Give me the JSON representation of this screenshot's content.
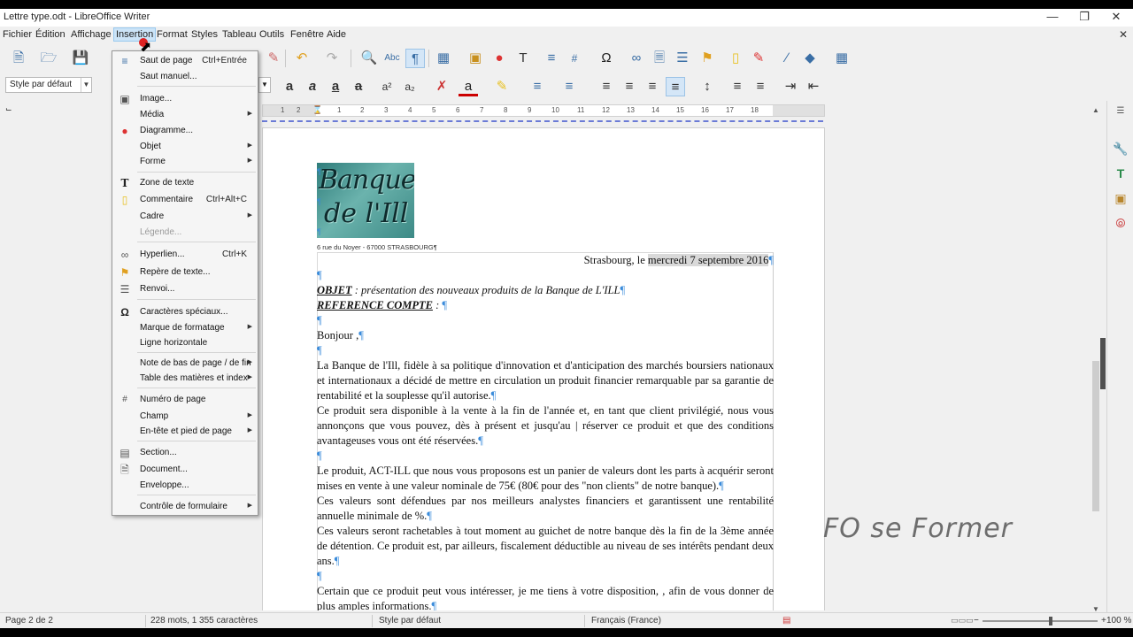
{
  "window": {
    "title": "Lettre type.odt - LibreOffice Writer",
    "minimize_icon": "minimize-icon",
    "maximize_icon": "maximize-icon",
    "close_icon": "close-icon"
  },
  "menubar": {
    "items": [
      "Fichier",
      "Édition",
      "Affichage",
      "Insertion",
      "Format",
      "Styles",
      "Tableau",
      "Outils",
      "Fenêtre",
      "Aide"
    ],
    "active": "Insertion"
  },
  "toolbar": {
    "paragraph_style": "Style par défaut"
  },
  "ruler": {
    "numbers": [
      "1",
      "2",
      "1",
      "2",
      "3",
      "4",
      "5",
      "6",
      "7",
      "8",
      "9",
      "10",
      "11",
      "12",
      "13",
      "14",
      "15",
      "16",
      "17",
      "18"
    ]
  },
  "insert_menu": {
    "items": [
      {
        "label": "Saut de page",
        "shortcut": "Ctrl+Entrée",
        "icon": "page-break-icon"
      },
      {
        "label": "Saut manuel...",
        "shortcut": "",
        "icon": ""
      },
      {
        "label": "Image...",
        "shortcut": "",
        "icon": "image-icon"
      },
      {
        "label": "Média",
        "shortcut": "",
        "icon": ""
      },
      {
        "label": "Diagramme...",
        "shortcut": "",
        "icon": "chart-icon"
      },
      {
        "label": "Objet",
        "shortcut": "",
        "icon": ""
      },
      {
        "label": "Forme",
        "shortcut": "",
        "icon": ""
      },
      {
        "label": "Zone de texte",
        "shortcut": "",
        "icon": "text-box-icon"
      },
      {
        "label": "Commentaire",
        "shortcut": "Ctrl+Alt+C",
        "icon": "comment-icon"
      },
      {
        "label": "Cadre",
        "shortcut": "",
        "icon": ""
      },
      {
        "label": "Légende...",
        "shortcut": "",
        "icon": ""
      },
      {
        "label": "Hyperlien...",
        "shortcut": "Ctrl+K",
        "icon": "hyperlink-icon"
      },
      {
        "label": "Repère de texte...",
        "shortcut": "",
        "icon": "bookmark-icon"
      },
      {
        "label": "Renvoi...",
        "shortcut": "",
        "icon": "cross-reference-icon"
      },
      {
        "label": "Caractères spéciaux...",
        "shortcut": "",
        "icon": "omega-icon"
      },
      {
        "label": "Marque de formatage",
        "shortcut": "",
        "icon": ""
      },
      {
        "label": "Ligne horizontale",
        "shortcut": "",
        "icon": ""
      },
      {
        "label": "Note de bas de page / de fin",
        "shortcut": "",
        "icon": ""
      },
      {
        "label": "Table des matières et index",
        "shortcut": "",
        "icon": ""
      },
      {
        "label": "Numéro de page",
        "shortcut": "",
        "icon": "page-number-icon"
      },
      {
        "label": "Champ",
        "shortcut": "",
        "icon": ""
      },
      {
        "label": "En-tête et pied de page",
        "shortcut": "",
        "icon": ""
      },
      {
        "label": "Section...",
        "shortcut": "",
        "icon": "section-icon"
      },
      {
        "label": "Document...",
        "shortcut": "",
        "icon": "document-icon"
      },
      {
        "label": "Enveloppe...",
        "shortcut": "",
        "icon": ""
      },
      {
        "label": "Contrôle de formulaire",
        "shortcut": "",
        "icon": ""
      }
    ]
  },
  "document": {
    "logo_line1": "Banque",
    "logo_line2": "de l'Ill",
    "address": "6 rue du Noyer - 67000 STRASBOURG¶",
    "date_prefix": "Strasbourg, le ",
    "date_value": "mercredi 7 septembre 2016",
    "objet_label": "OBJET",
    "objet_text": " : présentation des nouveaux produits de la Banque de L'ILL",
    "reference_label": "REFERENCE COMPTE",
    "reference_suffix": " : ",
    "greeting": "Bonjour ,",
    "p1": "La Banque de l'Ill, fidèle à sa politique d'innovation et d'anticipation des marchés boursiers nationaux et internationaux a décidé de mettre en circulation un produit financier remarquable par sa garantie de rentabilité et la souplesse qu'il autorise.",
    "p2": "Ce produit sera disponible à la vente à la fin de l'année et, en tant que client privilégié, nous vous annonçons que vous pouvez, dès à présent et jusqu'au | réserver ce produit et que des conditions avantageuses vous ont été réservées.",
    "p3": "Le produit, ACT-ILL que nous vous proposons est un panier de valeurs dont les parts à acquérir seront mises en vente à une valeur nominale de 75€ (80€ pour des \"non clients\" de notre banque).",
    "p4": "Ces valeurs sont défendues par nos meilleurs analystes financiers et garantissent une rentabilité annuelle minimale de  %.",
    "p5": "Ces valeurs seront rachetables à tout moment au guichet de notre banque dès la fin de la 3ème année de détention. Ce produit est, par ailleurs, fiscalement déductible au niveau de ses intérêts pendant deux ans.",
    "p6": "Certain que ce produit peut vous intéresser, je me tiens à votre disposition,  , afin de vous donner de plus amples informations.",
    "pilcrow": "¶"
  },
  "watermark": "FO se Former",
  "statusbar": {
    "page": "Page 2 de 2",
    "words": "228 mots, 1 355 caractères",
    "style": "Style par défaut",
    "language": "Français (France)",
    "zoom": "100 %"
  }
}
